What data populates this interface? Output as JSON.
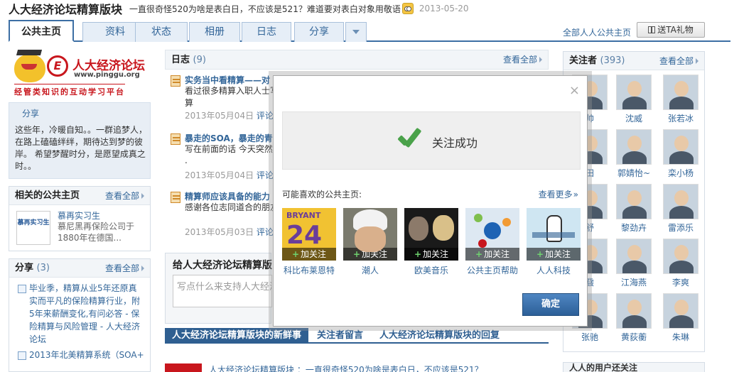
{
  "header": {
    "title": "人大经济论坛精算版块",
    "motto": "一直很奇怪520为啥是表白日，不应该是521？难道要对表白对象用敬语",
    "date": "2013-05-20"
  },
  "tabs": [
    "公共主页",
    "资料",
    "状态",
    "相册",
    "日志",
    "分享"
  ],
  "top_links": {
    "all_pages": "全部人人公共主页",
    "gift": "送TA礼物"
  },
  "logo": {
    "name": "人大经济论坛",
    "url": "www.pinggu.org",
    "slogan": "经管类知识的互动学习平台",
    "seal": "E"
  },
  "intro": {
    "share_label": "分享",
    "text": "这些年，冷暖自知。。一群追梦人，在路上磕磕绊绊，期待达到梦的彼岸。 希望梦醒时分，是愿望成真之时。。"
  },
  "related": {
    "title": "相关的公共主页",
    "more": "查看全部",
    "item": {
      "thumb": "慕再实习生",
      "name": "慕再实习生",
      "desc": "慕尼黑再保险公司于1880年在德国..."
    }
  },
  "share_panel": {
    "title": "分享",
    "count": "(3)",
    "more": "查看全部",
    "items": [
      "毕业季，精算从业5年还原真实而平凡的保险精算行业，附5年来薪酬变化,有问必答 - 保险精算与风险管理 - 人大经济论坛",
      "2013年北美精算系统（SOA+"
    ]
  },
  "diary": {
    "title": "日志",
    "count": "(9)",
    "more": "查看全部",
    "entries": [
      {
        "title": "实务当中看精算——对",
        "excerpt": "看过很多精算入职人士写的文章，很少能解决大家对于精算",
        "date": "2013年05月04日",
        "action": "评论"
      },
      {
        "title": "暴走的SOA，暴走的青",
        "excerpt": "写在前面的话 今天突然",
        "extra": ".",
        "date": "2013年05月04日",
        "action": "评论"
      },
      {
        "title": "精算师应该具备的能力",
        "excerpt": "感谢各位志同道合的朋友，真的没有那么美好。我还",
        "date": "2013年05月03日",
        "action": "评论"
      }
    ]
  },
  "compose": {
    "title": "给人大经济论坛精算版",
    "placeholder": "写点什么来支持人大经济"
  },
  "bottom_tabs": [
    "人大经济论坛精算版块的新鲜事",
    "关注者留言",
    "人大经济论坛精算版块的回复"
  ],
  "bottom_row": "人大经济论坛精算版块 ：一直很奇怪520为啥是表白日，不应该是521？",
  "followers": {
    "title": "关注者",
    "count": "(393)",
    "more": "查看全部",
    "names": [
      "帅",
      "沈威",
      "张若冰",
      "田",
      "郭婧怡~",
      "栾小杨",
      "舒",
      "黎劲卉",
      "雷添乐",
      "鼗",
      "江海燕",
      "李爽",
      "张驰",
      "黄荻蘅",
      "朱琳"
    ]
  },
  "right_bottom": "人人的用户还关注",
  "modal": {
    "close": "×",
    "success": "关注成功",
    "rec_label": "可能喜欢的公共主页:",
    "rec_more": "查看更多",
    "follow_label": "加关注",
    "tile1_brand": "BRYANT",
    "tile1_number": "24",
    "tiles": [
      "科比布莱恩特",
      "潮人",
      "欧美音乐",
      "公共主页帮助",
      "人人科技"
    ],
    "confirm": "确定"
  },
  "colors": {
    "accent": "#3d6fa4",
    "link": "#336699",
    "brand_red": "#c8161d",
    "success_green": "#4aa24a"
  }
}
